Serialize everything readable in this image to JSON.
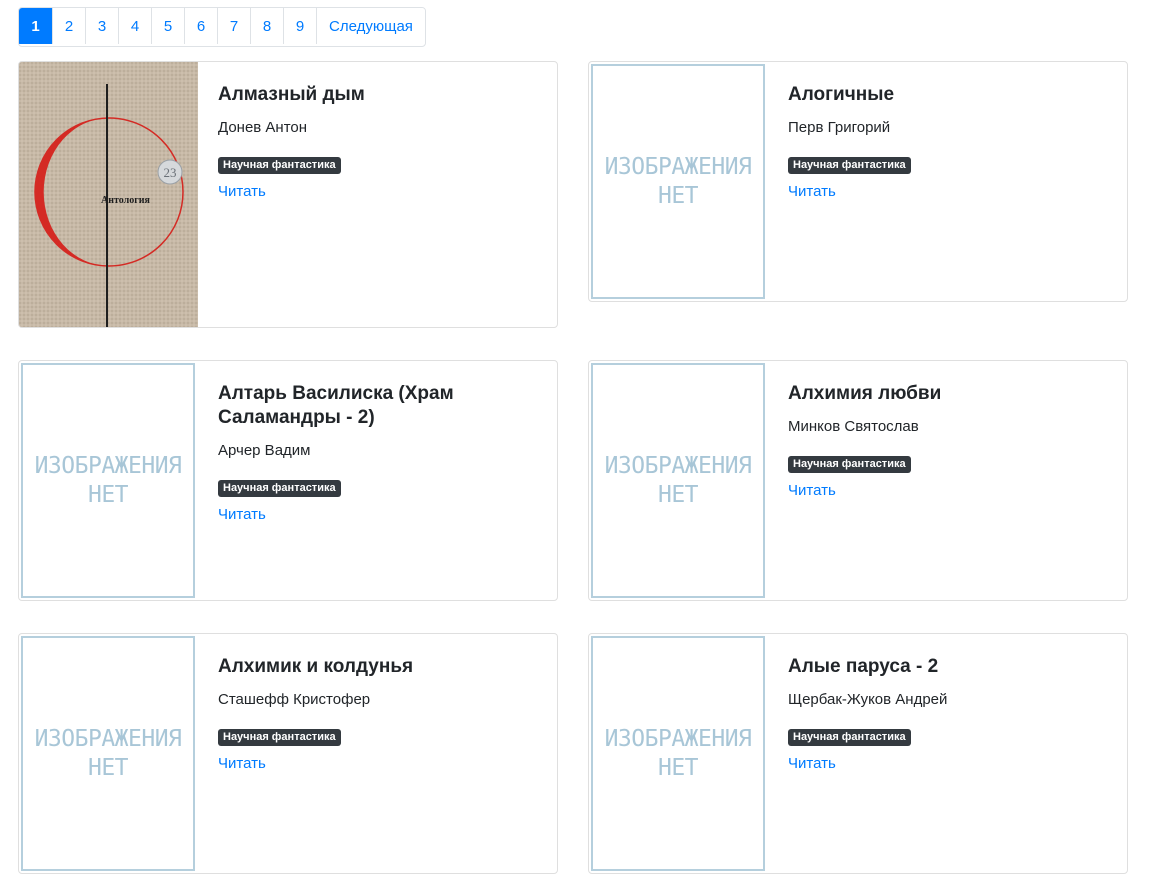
{
  "pagination": {
    "pages": [
      "1",
      "2",
      "3",
      "4",
      "5",
      "6",
      "7",
      "8",
      "9"
    ],
    "active": "1",
    "next_label": "Следующая"
  },
  "placeholder": {
    "text": "ИЗОБРАЖЕНИЯ\nНЕТ"
  },
  "books": [
    {
      "title": "Алмазный дым",
      "author": "Донев Антон",
      "genre": "Научная фантастика",
      "read_label": "Читать",
      "cover": "image",
      "cover_text": "Антология",
      "cover_number": "23"
    },
    {
      "title": "Алогичные",
      "author": "Перв Григорий",
      "genre": "Научная фантастика",
      "read_label": "Читать",
      "cover": "none"
    },
    {
      "title": "Алтарь Василиска (Храм Саламандры - 2)",
      "author": "Арчер Вадим",
      "genre": "Научная фантастика",
      "read_label": "Читать",
      "cover": "none"
    },
    {
      "title": "Алхимия любви",
      "author": "Минков Святослав",
      "genre": "Научная фантастика",
      "read_label": "Читать",
      "cover": "none"
    },
    {
      "title": "Алхимик и колдунья",
      "author": "Сташефф Кристофер",
      "genre": "Научная фантастика",
      "read_label": "Читать",
      "cover": "none"
    },
    {
      "title": "Алые паруса - 2",
      "author": "Щербак-Жуков Андрей",
      "genre": "Научная фантастика",
      "read_label": "Читать",
      "cover": "none"
    }
  ],
  "colors": {
    "primary": "#007bff",
    "badge": "#343a40",
    "placeholder": "#a8c6d7"
  }
}
